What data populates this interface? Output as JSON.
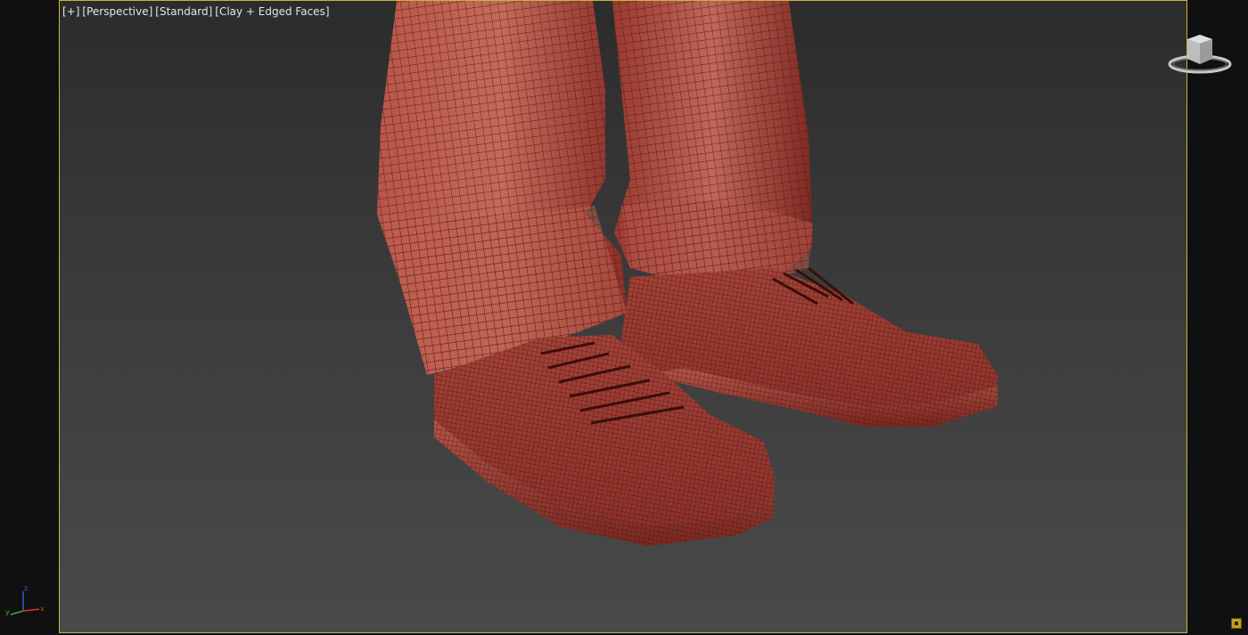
{
  "viewport": {
    "labels": {
      "plus": "[+]",
      "view": "[Perspective]",
      "shading_style": "[Standard]",
      "display_mode": "[Clay + Edged Faces]"
    },
    "active_border_color": "#c9b43a",
    "background_top_color": "#2c2c2c",
    "background_bottom_color": "#4a4a4a"
  },
  "model": {
    "clay_color": "#a8463c",
    "wire_color": "#4a1612"
  },
  "axis_tripod": {
    "x_label": "x",
    "y_label": "y",
    "z_label": "z",
    "x_color": "#d03a2c",
    "y_color": "#3ab03a",
    "z_color": "#3a5ad0"
  },
  "icons": {
    "viewcube": "viewcube-icon",
    "corner": "maximize-viewport-icon"
  }
}
